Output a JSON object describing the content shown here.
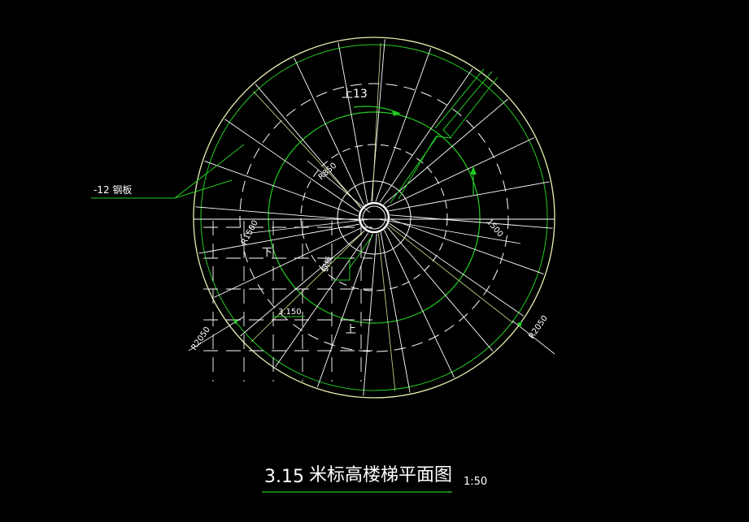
{
  "drawing": {
    "background": "#000000",
    "colors": {
      "outline": "#e8f0b0",
      "treads": "#ffffff",
      "steel": "#22cc22",
      "dashed": "#ffffff",
      "hidden": "#ffffff"
    },
    "labels": {
      "up_top": "上13",
      "down": "下",
      "up_bottom": "上",
      "steel_plate": "-12  钢板",
      "dim_r850": "R850",
      "dim_r1500_left": "R1500",
      "dim_r1500_right": "1500",
      "dim_r2050_left": "R2050",
      "dim_r2050_right": "R2050",
      "elev_label": "3.150",
      "slab_label": "钢板"
    },
    "title": {
      "number": "3.15",
      "name": "米标高楼梯平面图",
      "scale": "1:50"
    }
  }
}
